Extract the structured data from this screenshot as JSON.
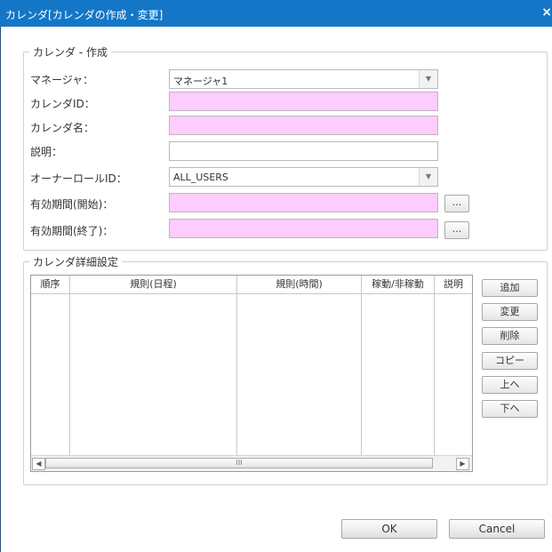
{
  "window": {
    "title": "カレンダ[カレンダの作成・変更]",
    "close_symbol": "×"
  },
  "create_group": {
    "legend": "カレンダ - 作成",
    "fields": [
      {
        "label": "マネージャ：",
        "value": "マネージャ1",
        "type": "select"
      },
      {
        "label": "カレンダID：",
        "value": "",
        "type": "text",
        "required": true
      },
      {
        "label": "カレンダ名：",
        "value": "",
        "type": "text",
        "required": true
      },
      {
        "label": "説明：",
        "value": "",
        "type": "text",
        "required": false
      },
      {
        "label": "オーナーロールID：",
        "value": "ALL_USERS",
        "type": "select"
      },
      {
        "label": "有効期間(開始)：",
        "value": "",
        "type": "text",
        "required": true,
        "button": "..."
      },
      {
        "label": "有効期間(終了)：",
        "value": "",
        "type": "text",
        "required": true,
        "button": "..."
      }
    ]
  },
  "detail_group": {
    "legend": "カレンダ詳細設定",
    "columns": [
      "順序",
      "規則(日程)",
      "規則(時間)",
      "稼動/非稼動",
      "説明"
    ],
    "rows": [],
    "scroll_thumb": "III"
  },
  "side_buttons": [
    "追加",
    "変更",
    "削除",
    "コピー",
    "上へ",
    "下へ"
  ],
  "footer": {
    "ok": "OK",
    "cancel": "Cancel"
  },
  "colors": {
    "titlebar": "#1476c6",
    "required_field": "#ffccff"
  }
}
